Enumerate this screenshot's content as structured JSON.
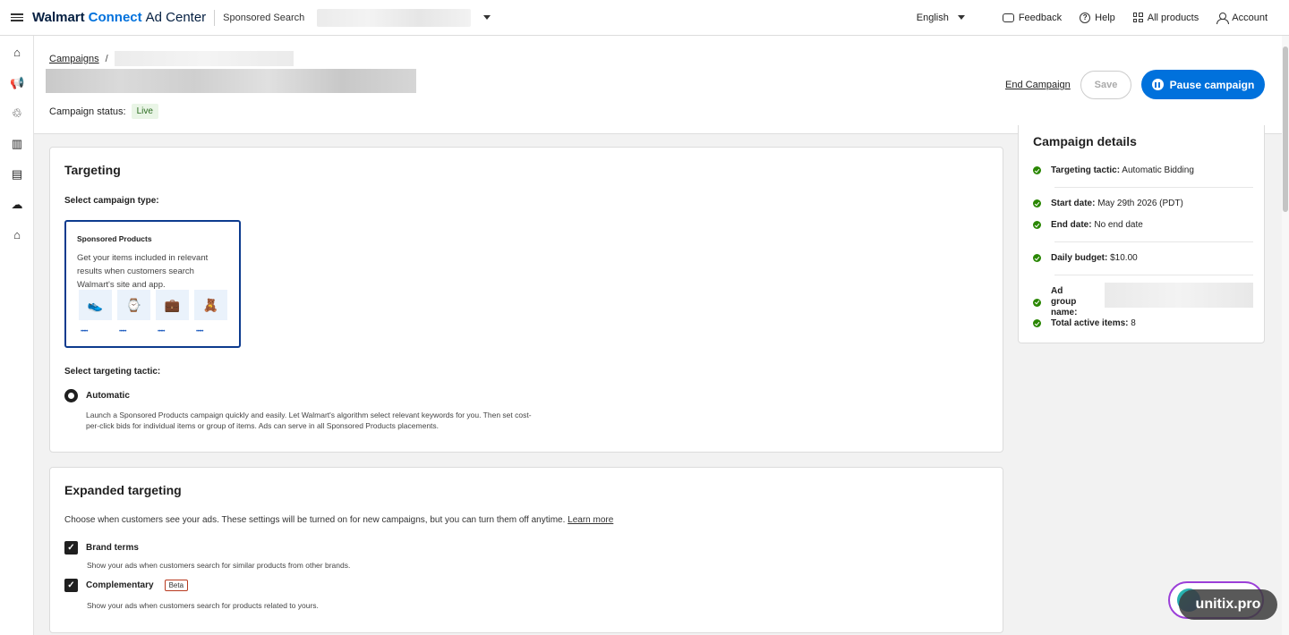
{
  "topbar": {
    "brand_part1": "Walmart",
    "brand_part2": "Connect",
    "brand_part3": "Ad Center",
    "product": "Sponsored Search",
    "language": "English",
    "feedback": "Feedback",
    "help": "Help",
    "all_products": "All products",
    "account": "Account"
  },
  "header": {
    "breadcrumb_link": "Campaigns",
    "breadcrumb_sep": "/",
    "status_label": "Campaign status:",
    "status_value": "Live",
    "end_campaign": "End Campaign",
    "save": "Save",
    "pause": "Pause campaign"
  },
  "targeting": {
    "title": "Targeting",
    "select_type_label": "Select campaign type:",
    "tile_title": "Sponsored Products",
    "tile_desc": "Get your items included in relevant results when customers search Walmart's site and app.",
    "stars": "•••••",
    "select_tactic_label": "Select targeting tactic:",
    "tactic_option": "Automatic",
    "tactic_desc": "Launch a Sponsored Products campaign quickly and easily. Let Walmart's algorithm select relevant keywords for you. Then set cost-per-click bids for individual items or group of items. Ads can serve in all Sponsored Products placements."
  },
  "expanded": {
    "title": "Expanded targeting",
    "desc": "Choose when customers see your ads. These settings will be turned on for new campaigns, but you can turn them off anytime.",
    "learn_more": "Learn more",
    "brand_terms_label": "Brand terms",
    "brand_terms_desc": "Show your ads when customers search for similar products from other brands.",
    "complementary_label": "Complementary",
    "beta": "Beta",
    "complementary_desc": "Show your ads when customers search for products related to yours."
  },
  "details": {
    "title": "Campaign details",
    "rows": [
      {
        "label": "Targeting tactic:",
        "value": "Automatic Bidding"
      },
      {
        "label": "Start date:",
        "value": "May 29th 2026 (PDT)"
      },
      {
        "label": "End date:",
        "value": "No end date"
      },
      {
        "label": "Daily budget:",
        "value": "$10.00"
      },
      {
        "label": "Ad group name:",
        "value": ""
      },
      {
        "label": "Total active items:",
        "value": "8"
      }
    ]
  },
  "watermark": "unitix.pro",
  "colors": {
    "accent": "#0071dc",
    "live_badge": "#e9f5e6",
    "check": "#2a8703"
  }
}
